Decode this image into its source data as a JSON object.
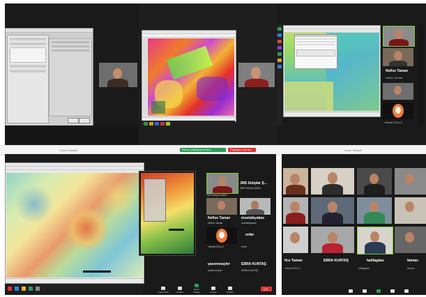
{
  "top_bar": {
    "center_label": "Zoom Toplantı"
  },
  "panels": {
    "top_left": {
      "zoom_title": "Zoom Toplantı"
    },
    "top_middle": {},
    "top_right": {
      "participants": [
        {
          "name": "Nefise Taman"
        },
        {
          "name": "Nefise Taman"
        },
        {
          "name": "Yakdal SOLLU"
        }
      ],
      "header": "Zoom Toplantı"
    },
    "bottom_left": {
      "participants": [
        {
          "name": "JMS Sıdıplar Ş..."
        },
        {
          "name": "JMS Sıdıplar Şakiri"
        },
        {
          "name": "Nefise Taman"
        },
        {
          "name": "mustafayakas"
        },
        {
          "name": "Nefise Taman"
        },
        {
          "name": "mustafayakas"
        },
        {
          "name": "Yakdal SOLLU"
        },
        {
          "name": "enfar"
        },
        {
          "name": "Yakdal SOLLU"
        },
        {
          "name": "enfar"
        },
        {
          "name": "yasemınayler"
        },
        {
          "name": "EBRA KUNTAŞ"
        },
        {
          "name": "yasemınayler"
        },
        {
          "name": "EBRA KUNTAŞ"
        }
      ],
      "leave_label": "Çık"
    },
    "bottom_right": {
      "header": "Zoom Toplantı",
      "name_row": [
        {
          "name": "fice Taman"
        },
        {
          "name": "EBRA KUNTAŞ"
        },
        {
          "name": "halifagdas"
        },
        {
          "name": "fatmac"
        }
      ],
      "bottom_labels": [
        "Yakdal SOLLU",
        "halifagdas",
        "fatmac"
      ]
    }
  },
  "share_banner": {
    "label": "Ekranı paylaşıyorsunuz",
    "button": "Paylaşımı durdur"
  },
  "controls": [
    {
      "label": "Katılımcılar",
      "count": "24"
    },
    {
      "label": "Sohbet"
    },
    {
      "label": "Ekran Paylaş"
    },
    {
      "label": "Kaydet"
    },
    {
      "label": "Tepkiler"
    }
  ]
}
